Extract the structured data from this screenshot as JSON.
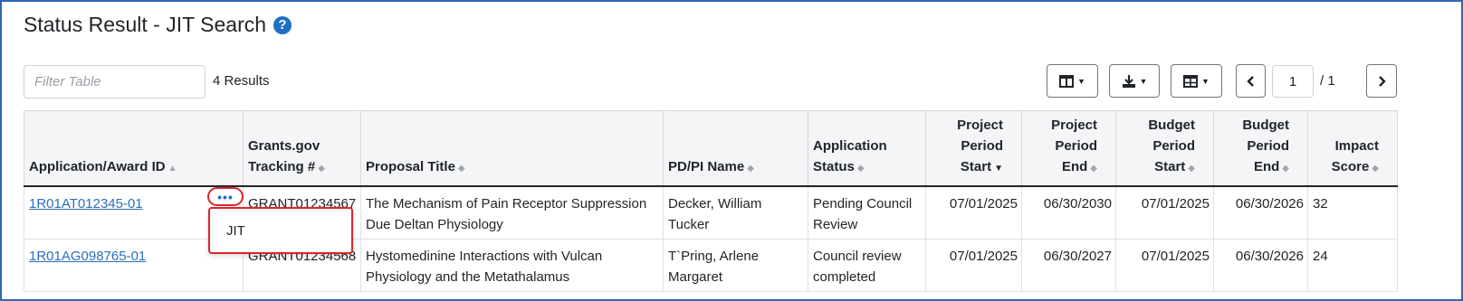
{
  "page": {
    "title": "Status Result - JIT Search",
    "help_icon": "?"
  },
  "toolbar": {
    "filter_placeholder": "Filter Table",
    "results_count": "4 Results",
    "page_current": "1",
    "page_total": "/ 1",
    "icons": [
      "columns-icon",
      "download-icon",
      "table-view-icon",
      "chevron-left-icon",
      "chevron-right-icon"
    ]
  },
  "table": {
    "headers": [
      {
        "lines": [
          "Application/Award ID"
        ],
        "sort": "none"
      },
      {
        "lines": [
          "Grants.gov",
          "Tracking #"
        ],
        "sort": "none"
      },
      {
        "lines": [
          "Proposal Title"
        ],
        "sort": "none"
      },
      {
        "lines": [
          "PD/PI Name"
        ],
        "sort": "none"
      },
      {
        "lines": [
          "Application",
          "Status"
        ],
        "sort": "none"
      },
      {
        "lines": [
          "Project",
          "Period",
          "Start"
        ],
        "sort": "desc"
      },
      {
        "lines": [
          "Project",
          "Period",
          "End"
        ],
        "sort": "none"
      },
      {
        "lines": [
          "Budget",
          "Period",
          "Start"
        ],
        "sort": "none"
      },
      {
        "lines": [
          "Budget",
          "Period",
          "End"
        ],
        "sort": "none"
      },
      {
        "lines": [
          "Impact",
          "Score"
        ],
        "sort": "none"
      }
    ],
    "rows": [
      {
        "id": "1R01AT012345-01",
        "tracking": "GRANT01234567",
        "title": "The Mechanism of Pain Receptor Suppression Due Deltan Physiology",
        "pi": "Decker, William Tucker",
        "status": "Pending Council Review",
        "proj_start": "07/01/2025",
        "proj_end": "06/30/2030",
        "budget_start": "07/01/2025",
        "budget_end": "06/30/2026",
        "impact": "32"
      },
      {
        "id": "1R01AG098765-01",
        "tracking": "GRANT01234568",
        "title": "Hystomedinine Interactions with Vulcan Physiology and the Metathalamus",
        "pi": "T`Pring, Arlene Margaret",
        "status": "Council review completed",
        "proj_start": "07/01/2025",
        "proj_end": "06/30/2027",
        "budget_start": "07/01/2025",
        "budget_end": "06/30/2026",
        "impact": "24"
      }
    ]
  },
  "actions_menu": {
    "trigger": "•••",
    "items": [
      "JIT"
    ]
  },
  "colors": {
    "link": "#2a6fbd",
    "highlight": "#d9262c",
    "frame": "#2f66b3",
    "header_bg": "#f4f5f7"
  }
}
